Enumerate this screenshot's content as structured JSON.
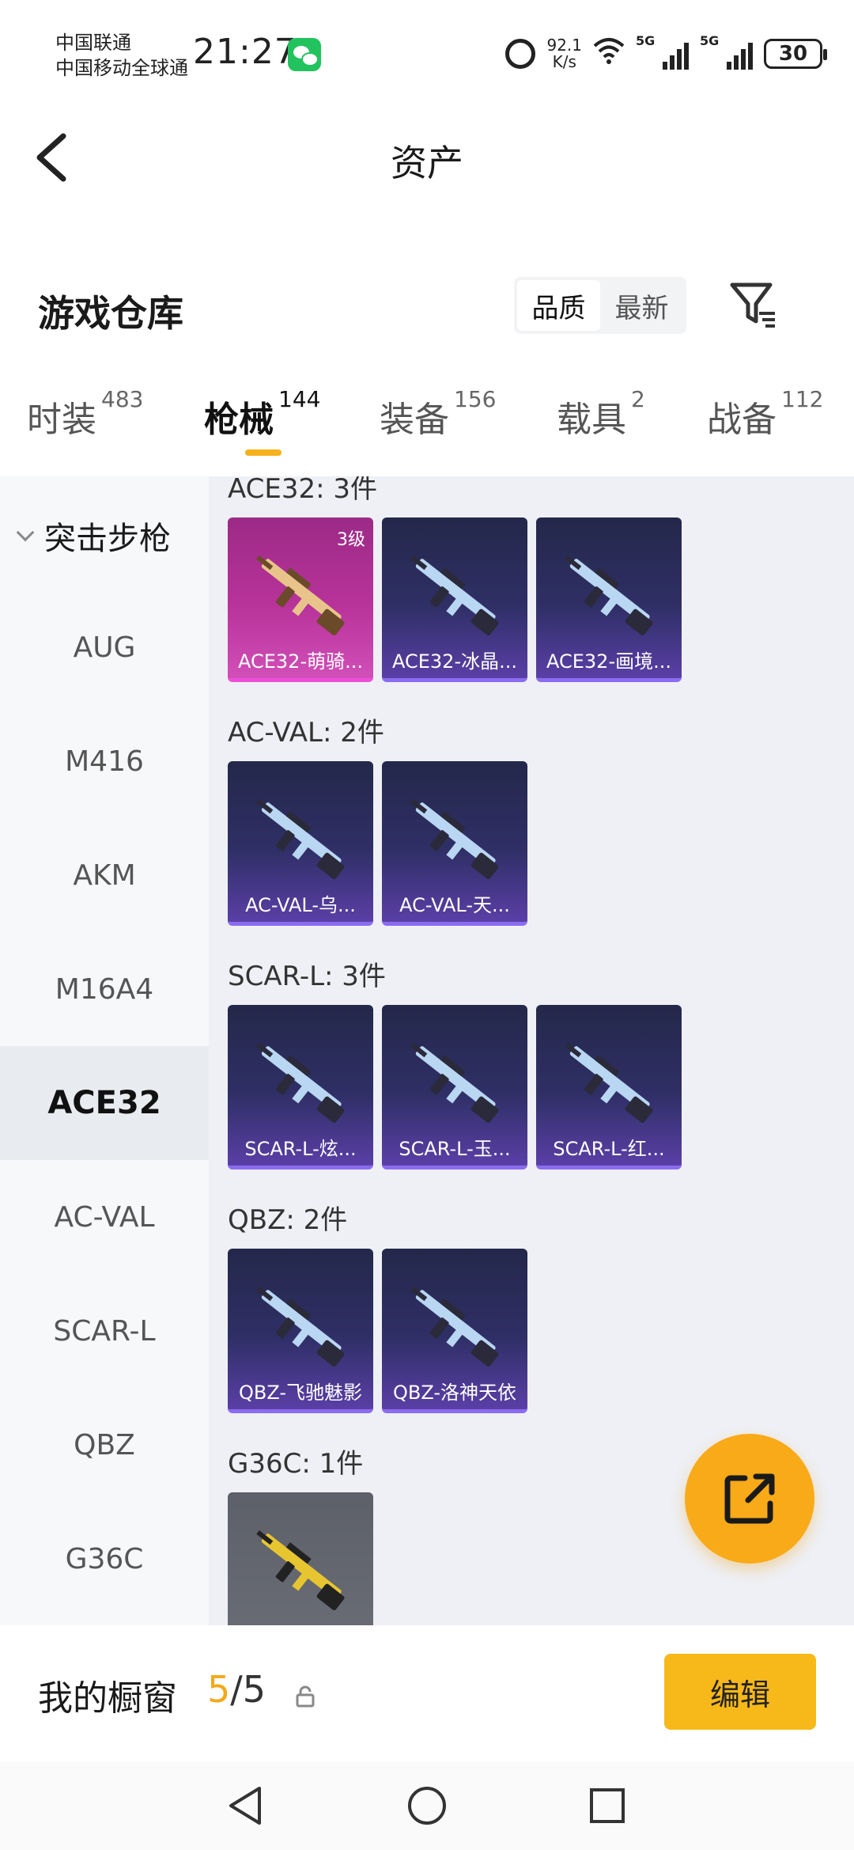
{
  "status_bar": {
    "carrier_1": "中国联通",
    "carrier_2": "中国移动全球通",
    "time": "21:27",
    "net_speed_value": "92.1",
    "net_speed_unit": "K/s",
    "signal_1": "5G",
    "signal_2": "5G",
    "battery": "30"
  },
  "header": {
    "title": "资产"
  },
  "section": {
    "title": "游戏仓库",
    "sort_options": [
      "品质",
      "最新"
    ],
    "sort_selected": "品质"
  },
  "tabs": [
    {
      "label": "时装",
      "count": "483"
    },
    {
      "label": "枪械",
      "count": "144"
    },
    {
      "label": "装备",
      "count": "156"
    },
    {
      "label": "载具",
      "count": "2"
    },
    {
      "label": "战备",
      "count": "112"
    }
  ],
  "active_tab": "枪械",
  "sidebar": {
    "category": "突击步枪",
    "items": [
      "AUG",
      "M416",
      "AKM",
      "M16A4",
      "ACE32",
      "AC-VAL",
      "SCAR-L",
      "QBZ",
      "G36C"
    ],
    "active": "ACE32"
  },
  "groups": [
    {
      "title": "ACE32: 3件",
      "items": [
        {
          "name": "ACE32-萌骑...",
          "level": "3级",
          "quality": "pink"
        },
        {
          "name": "ACE32-冰晶...",
          "quality": "purple"
        },
        {
          "name": "ACE32-画境...",
          "quality": "purple"
        }
      ]
    },
    {
      "title": "AC-VAL: 2件",
      "items": [
        {
          "name": "AC-VAL-乌...",
          "quality": "purple"
        },
        {
          "name": "AC-VAL-天...",
          "quality": "purple"
        }
      ]
    },
    {
      "title": "SCAR-L: 3件",
      "items": [
        {
          "name": "SCAR-L-炫...",
          "quality": "purple"
        },
        {
          "name": "SCAR-L-玉...",
          "quality": "purple"
        },
        {
          "name": "SCAR-L-红...",
          "quality": "purple"
        }
      ]
    },
    {
      "title": "QBZ: 2件",
      "items": [
        {
          "name": "QBZ-飞驰魅影",
          "quality": "purple"
        },
        {
          "name": "QBZ-洛神天依",
          "quality": "purple"
        }
      ]
    },
    {
      "title": "G36C: 1件",
      "items": [
        {
          "name": "",
          "quality": "grey"
        }
      ]
    }
  ],
  "showcase": {
    "label": "我的橱窗",
    "used": "5",
    "total": "/5",
    "edit_label": "编辑"
  },
  "icons": [
    "back-arrow-icon",
    "filter-icon",
    "share-icon",
    "lock-icon",
    "alarm-icon",
    "wifi-icon",
    "wechat-icon"
  ],
  "colors": {
    "accent": "#f6b21a",
    "fab": "#f9aa18",
    "card_purple": "#2f2f66",
    "card_pink": "#b8339a"
  }
}
